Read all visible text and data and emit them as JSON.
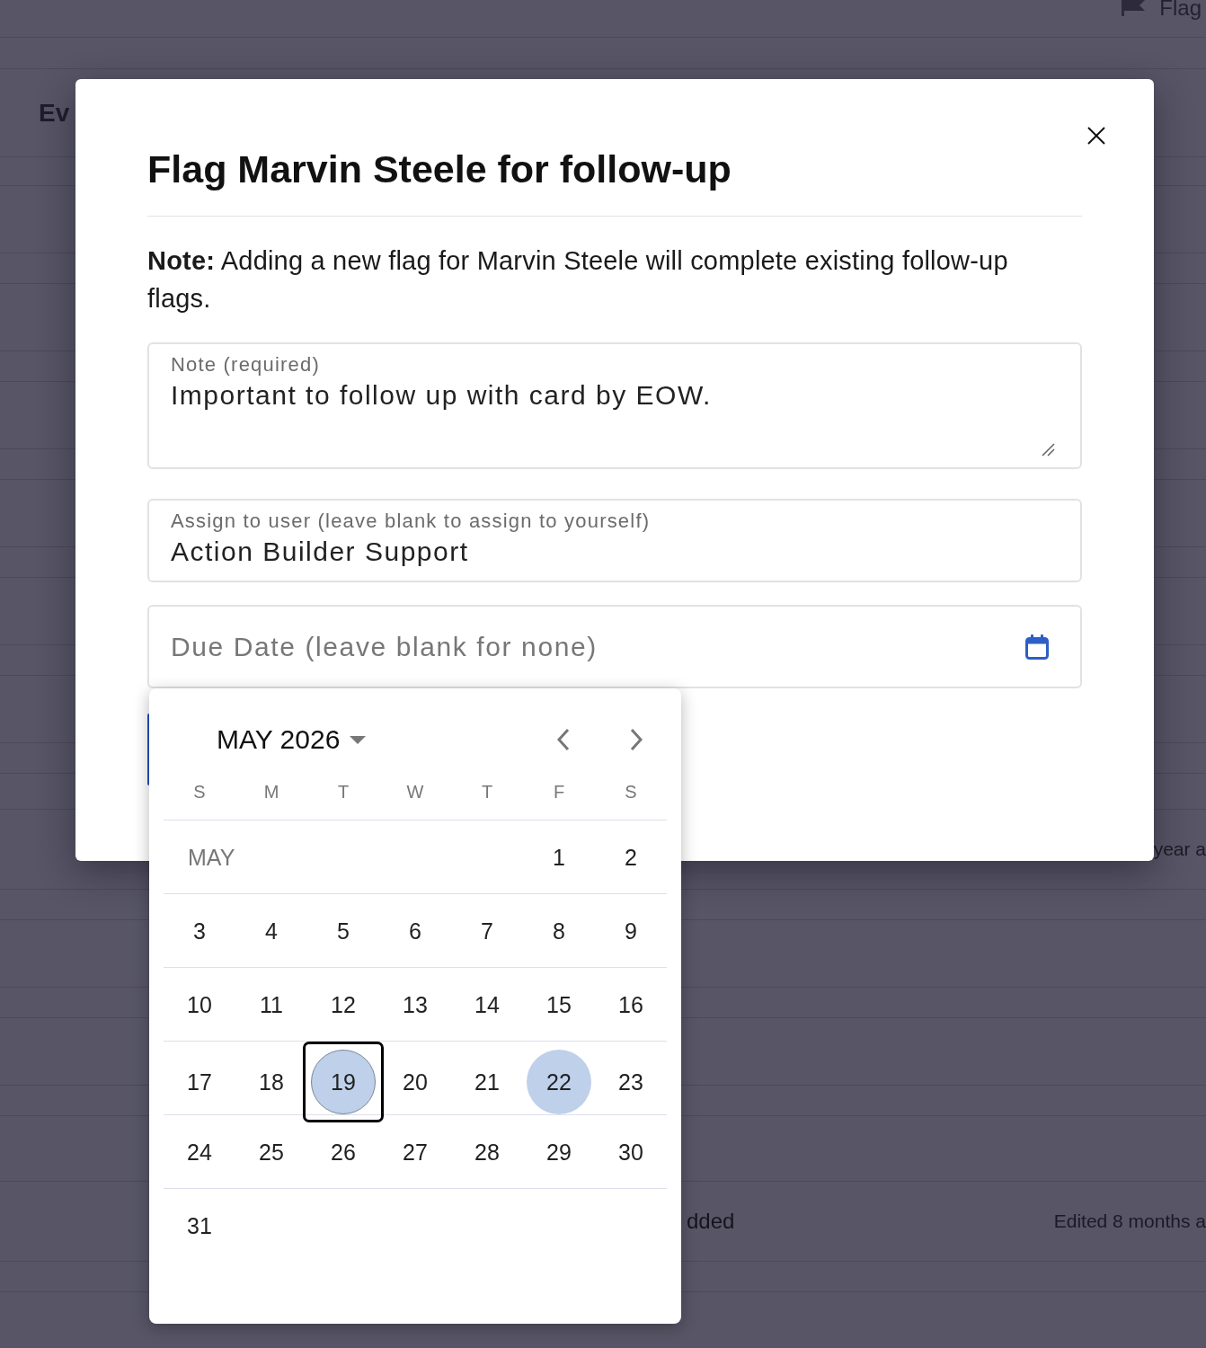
{
  "background_page": {
    "flag_button": {
      "label": "Flag"
    },
    "heading": "Ev",
    "rows": [
      {
        "column_3": "year a"
      },
      {
        "column_2": "dded",
        "column_3": "Edited 8 months a"
      }
    ]
  },
  "modal": {
    "title": "Flag Marvin Steele for follow-up",
    "note": "**Note:** Adding a new flag for Marvin Steele will complete existing follow-up flags.",
    "fields": [
      {
        "kind": "textarea",
        "label": "Note (required)",
        "value": "Important to follow up with card by EOW."
      },
      {
        "kind": "text",
        "label": "Assign to user (leave blank to assign to yourself)",
        "value": "Action Builder Support"
      },
      {
        "kind": "date",
        "placeholder": "Due Date (leave blank for none)"
      }
    ]
  },
  "date_picker": {
    "month_year": "MAY 2026",
    "weekdays": [
      "S",
      "M",
      "T",
      "W",
      "T",
      "F",
      "S"
    ],
    "month_label": "MAY",
    "weeks": [
      {
        "days": [
          {
            "label": "1",
            "selected": false,
            "today": false,
            "focused": false
          },
          {
            "label": "2",
            "selected": false,
            "today": false,
            "focused": false
          }
        ]
      },
      {
        "days": [
          {
            "label": "3",
            "selected": false,
            "today": false,
            "focused": false
          },
          {
            "label": "4",
            "selected": false,
            "today": false,
            "focused": false
          },
          {
            "label": "5",
            "selected": false,
            "today": false,
            "focused": false
          },
          {
            "label": "6",
            "selected": false,
            "today": false,
            "focused": false
          },
          {
            "label": "7",
            "selected": false,
            "today": false,
            "focused": false
          },
          {
            "label": "8",
            "selected": false,
            "today": false,
            "focused": false
          },
          {
            "label": "9",
            "selected": false,
            "today": false,
            "focused": false
          }
        ]
      },
      {
        "days": [
          {
            "label": "10",
            "selected": false,
            "today": false,
            "focused": false
          },
          {
            "label": "11",
            "selected": false,
            "today": false,
            "focused": false
          },
          {
            "label": "12",
            "selected": false,
            "today": false,
            "focused": false
          },
          {
            "label": "13",
            "selected": false,
            "today": false,
            "focused": false
          },
          {
            "label": "14",
            "selected": false,
            "today": false,
            "focused": false
          },
          {
            "label": "15",
            "selected": false,
            "today": false,
            "focused": false
          },
          {
            "label": "16",
            "selected": false,
            "today": false,
            "focused": false
          }
        ]
      },
      {
        "days": [
          {
            "label": "17",
            "selected": false,
            "today": false,
            "focused": false
          },
          {
            "label": "18",
            "selected": false,
            "today": false,
            "focused": false
          },
          {
            "label": "19",
            "selected": true,
            "today": true,
            "focused": true
          },
          {
            "label": "20",
            "selected": false,
            "today": false,
            "focused": false
          },
          {
            "label": "21",
            "selected": false,
            "today": false,
            "focused": false
          },
          {
            "label": "22",
            "selected": true,
            "today": false,
            "focused": false
          },
          {
            "label": "23",
            "selected": false,
            "today": false,
            "focused": false
          }
        ]
      },
      {
        "days": [
          {
            "label": "24",
            "selected": false,
            "today": false,
            "focused": false
          },
          {
            "label": "25",
            "selected": false,
            "today": false,
            "focused": false
          },
          {
            "label": "26",
            "selected": false,
            "today": false,
            "focused": false
          },
          {
            "label": "27",
            "selected": false,
            "today": false,
            "focused": false
          },
          {
            "label": "28",
            "selected": false,
            "today": false,
            "focused": false
          },
          {
            "label": "29",
            "selected": false,
            "today": false,
            "focused": false
          },
          {
            "label": "30",
            "selected": false,
            "today": false,
            "focused": false
          }
        ]
      },
      {
        "days": [
          {
            "label": "31",
            "selected": false,
            "today": false,
            "focused": false
          }
        ]
      }
    ]
  }
}
